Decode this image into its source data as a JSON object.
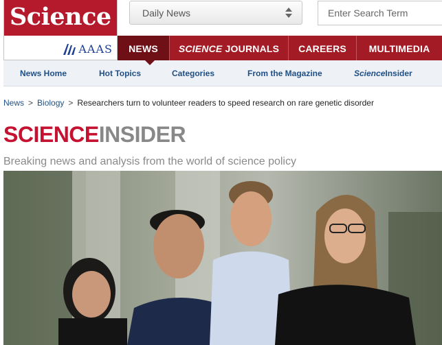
{
  "logo": {
    "wordmark": "Science",
    "publisher": "AAAS"
  },
  "edition_select": {
    "selected": "Daily News"
  },
  "search": {
    "placeholder": "Enter Search Term"
  },
  "main_nav": {
    "news": "NEWS",
    "journals_em": "SCIENCE",
    "journals_rest": " JOURNALS",
    "careers": "CAREERS",
    "multimedia": "MULTIMEDIA"
  },
  "sub_nav": {
    "news_home": "News Home",
    "hot_topics": "Hot Topics",
    "categories": "Categories",
    "from_magazine": "From the Magazine",
    "insider_em": "Science",
    "insider_rest": "Insider"
  },
  "breadcrumb": {
    "news": "News",
    "biology": "Biology",
    "separator": ">",
    "current": "Researchers turn to volunteer readers to speed research on rare genetic disorder"
  },
  "section": {
    "title_part1": "SCIENCE",
    "title_part2": "INSIDER",
    "tagline": "Breaking news and analysis from the world of science policy"
  },
  "colors": {
    "brand_red": "#b41a2c",
    "nav_red": "#a31b24",
    "nav_active": "#6e1016",
    "link_blue": "#1f4f86"
  }
}
